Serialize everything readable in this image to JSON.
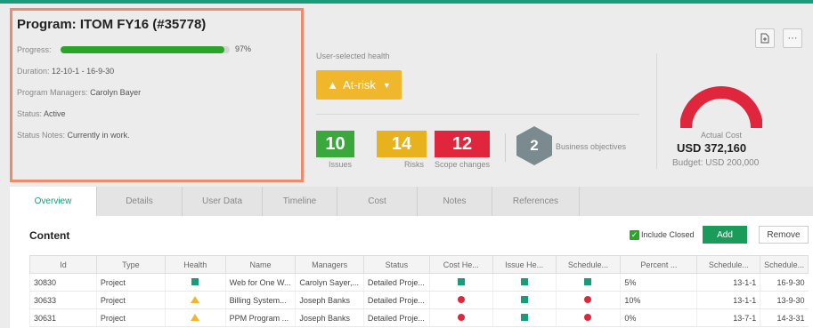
{
  "program": {
    "title": "Program: ITOM FY16 (#35778)",
    "progress_label": "Progress:",
    "progress_percent": 97,
    "progress_text": "97%",
    "duration_label": "Duration:",
    "duration_value": "12-10-1 - 16-9-30",
    "managers_label": "Program Managers:",
    "managers_value": "Carolyn Bayer",
    "status_label": "Status:",
    "status_value": "Active",
    "notes_label": "Status Notes:",
    "notes_value": "Currently in work."
  },
  "health": {
    "label": "User-selected health",
    "value": "At-risk"
  },
  "counts": [
    {
      "value": "10",
      "label": "Issues",
      "color": "#3aa83a"
    },
    {
      "value": "14",
      "label": "Risks",
      "color": "#e8b21e"
    },
    {
      "value": "12",
      "label": "Scope changes",
      "color": "#e0263c"
    }
  ],
  "objectives": {
    "value": "2",
    "label": "Business objectives"
  },
  "cost": {
    "label": "Actual Cost",
    "value": "USD 372,160",
    "budget": "Budget: USD 200,000",
    "gauge_color": "#e0263c"
  },
  "tabs": [
    "Overview",
    "Details",
    "User Data",
    "Timeline",
    "Cost",
    "Notes",
    "References"
  ],
  "content": {
    "title": "Content",
    "include_closed": "Include Closed",
    "add_label": "Add",
    "remove_label": "Remove"
  },
  "table": {
    "headers": [
      "Id",
      "Type",
      "Health",
      "Name",
      "Managers",
      "Status",
      "Cost He...",
      "Issue He...",
      "Schedule...",
      "Percent ...",
      "Schedule...",
      "Schedule..."
    ],
    "rows": [
      {
        "id": "30830",
        "type": "Project",
        "health": "square",
        "name": "Web for One W...",
        "managers": "Carolyn Sayer,...",
        "status": "Detailed Proje...",
        "cost": "square",
        "issue": "square",
        "schedule": "square",
        "percent": "5%",
        "start": "13-1-1",
        "end": "16-9-30"
      },
      {
        "id": "30633",
        "type": "Project",
        "health": "triangle",
        "name": "Billing System...",
        "managers": "Joseph Banks",
        "status": "Detailed Proje...",
        "cost": "dot",
        "issue": "square",
        "schedule": "dot",
        "percent": "10%",
        "start": "13-1-1",
        "end": "13-9-30"
      },
      {
        "id": "30631",
        "type": "Project",
        "health": "triangle",
        "name": "PPM Program ...",
        "managers": "Joseph Banks",
        "status": "Detailed Proje...",
        "cost": "dot",
        "issue": "square",
        "schedule": "dot",
        "percent": "0%",
        "start": "13-7-1",
        "end": "14-3-31"
      }
    ]
  },
  "colors": {
    "accent": "#1a9b7a",
    "highlight_border": "#f08a6c",
    "at_risk": "#f0b62c"
  },
  "icons": [
    "export-icon",
    "more-icon",
    "warning-icon",
    "caret-down-icon",
    "check-icon"
  ]
}
